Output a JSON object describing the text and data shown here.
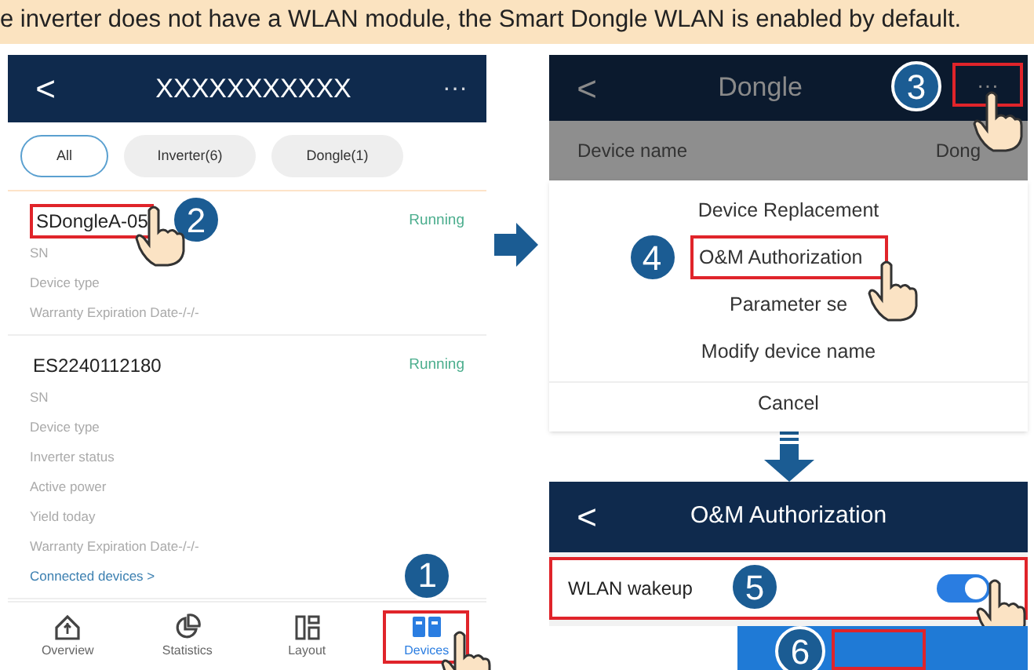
{
  "banner": "e inverter does not have a WLAN module, the Smart Dongle WLAN is enabled by default.",
  "devices_screen": {
    "back": "<",
    "title": "XXXXXXXXXXX",
    "more": "···",
    "filters": [
      {
        "label": "All",
        "selected": true
      },
      {
        "label": "Inverter(6)",
        "selected": false
      },
      {
        "label": "Dongle(1)",
        "selected": false
      }
    ],
    "devices": [
      {
        "name": "SDongleA-05",
        "status": "Running",
        "highlighted": true,
        "step": "2",
        "fields": [
          "SN",
          "Device type",
          "Warranty Expiration Date-/-/-"
        ]
      },
      {
        "name": "ES2240112180",
        "status": "Running",
        "highlighted": false,
        "fields": [
          "SN",
          "Device type",
          "Inverter status",
          "Active power",
          "Yield today",
          "Warranty Expiration Date-/-/-"
        ],
        "link": "Connected devices >"
      }
    ],
    "nav": [
      {
        "kind": "home",
        "label": "Overview",
        "selected": false
      },
      {
        "kind": "pie",
        "label": "Statistics",
        "selected": false
      },
      {
        "kind": "layout",
        "label": "Layout",
        "selected": false
      },
      {
        "kind": "devices",
        "label": "Devices",
        "selected": true,
        "step": "1"
      }
    ]
  },
  "dongle_screen": {
    "back": "<",
    "title": "Dongle",
    "more": "···",
    "step": "3",
    "row_label": "Device name",
    "row_value": "Dong",
    "menu": [
      {
        "label": "Device Replacement",
        "highlighted": false
      },
      {
        "label": "O&M Authorization",
        "highlighted": true,
        "step": "4"
      },
      {
        "label": "Parameter se",
        "highlighted": false
      },
      {
        "label": "Modify device name",
        "highlighted": false
      }
    ],
    "cancel": "Cancel"
  },
  "auth_screen": {
    "back": "<",
    "title": "O&M Authorization",
    "setting": {
      "label": "WLAN wakeup",
      "on": true,
      "step": "5"
    },
    "confirm_step": "6"
  }
}
